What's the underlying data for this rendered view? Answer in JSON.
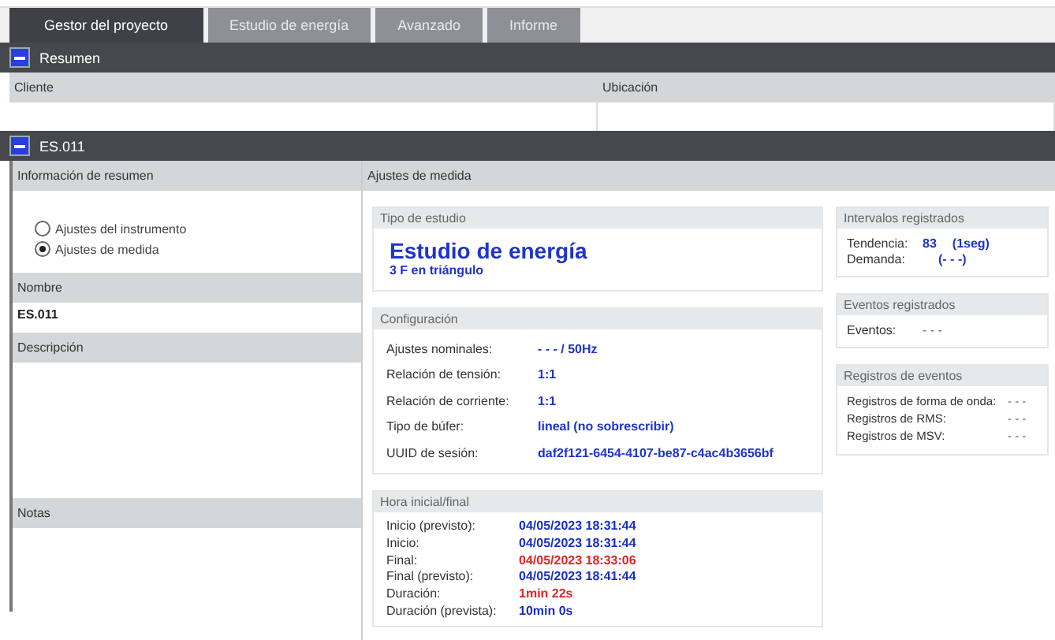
{
  "tabs": [
    {
      "label": "Gestor del proyecto",
      "selected": true
    },
    {
      "label": "Estudio de energía",
      "selected": false
    },
    {
      "label": "Avanzado",
      "selected": false
    },
    {
      "label": "Informe",
      "selected": false
    }
  ],
  "summary": {
    "title": "Resumen",
    "expanded": true,
    "columns": [
      "Cliente",
      "Ubicación"
    ]
  },
  "project": {
    "title": "ES.011",
    "expanded": true
  },
  "left": {
    "header": "Información de resumen",
    "radios": [
      {
        "label": "Ajustes del instrumento",
        "selected": false
      },
      {
        "label": "Ajustes de medida",
        "selected": true
      }
    ],
    "name_label": "Nombre",
    "name_value": "ES.011",
    "description_label": "Descripción",
    "notes_label": "Notas"
  },
  "middle": {
    "header": "Ajustes de medida",
    "study": {
      "title": "Tipo de estudio",
      "name": "Estudio de energía",
      "subtitle": "3 F en triángulo"
    },
    "config": {
      "title": "Configuración",
      "rows": [
        {
          "label": "Ajustes nominales:",
          "value": "- - - / 50Hz"
        },
        {
          "label": "Relación de tensión:",
          "value": "1:1"
        },
        {
          "label": "Relación de corriente:",
          "value": "1:1"
        },
        {
          "label": "Tipo de búfer:",
          "value": "lineal (no sobrescribir)"
        },
        {
          "label": "UUID de sesión:",
          "value": "daf2f121-6454-4107-be87-c4ac4b3656bf"
        }
      ]
    },
    "times": {
      "title": "Hora inicial/final",
      "rows": [
        {
          "label": "Inicio (previsto):",
          "value": "04/05/2023 18:31:44",
          "color": "#1a2fc0"
        },
        {
          "label": "Inicio:",
          "value": "04/05/2023 18:31:44",
          "color": "#1a2fc0"
        },
        {
          "label": "Final:",
          "value": "04/05/2023 18:33:06",
          "color": "#e02424"
        },
        {
          "label": "Final (previsto):",
          "value": "04/05/2023 18:41:44",
          "color": "#1a2fc0"
        },
        {
          "label": "Duración:",
          "value": "1min 22s",
          "color": "#e02424"
        },
        {
          "label": "Duración (prevista):",
          "value": "10min 0s",
          "color": "#1a2fc0"
        }
      ]
    }
  },
  "right": [
    {
      "title": "Intervalos registrados",
      "rows": [
        {
          "label": "Tendencia:",
          "value": "83",
          "extra": "(1seg)"
        },
        {
          "label": "Demanda:",
          "value": "",
          "extra": "(- - -)"
        }
      ]
    },
    {
      "title": "Eventos registrados",
      "rows": [
        {
          "label": "Eventos:",
          "value": "- - -"
        }
      ]
    },
    {
      "title": "Registros de eventos",
      "rows": [
        {
          "label": "Registros de forma de onda:",
          "value": "- - -"
        },
        {
          "label": "Registros de RMS:",
          "value": "- - -"
        },
        {
          "label": "Registros de MSV:",
          "value": "- - -"
        }
      ]
    }
  ]
}
